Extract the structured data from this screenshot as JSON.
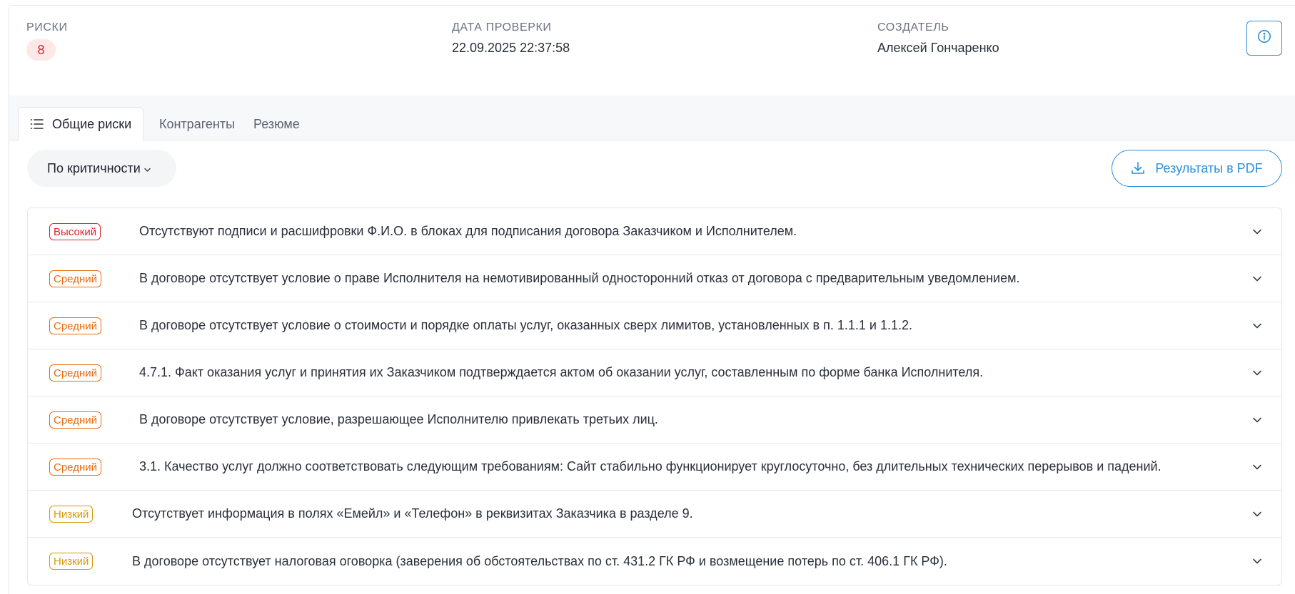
{
  "header": {
    "risks_label": "РИСКИ",
    "risks_count": "8",
    "date_label": "ДАТА ПРОВЕРКИ",
    "date_value": "22.09.2025 22:37:58",
    "creator_label": "СОЗДАТЕЛЬ",
    "creator_value": "Алексей Гончаренко",
    "info_icon": "info-circle-icon"
  },
  "tabs": [
    {
      "label": "Общие риски",
      "icon": "list-icon",
      "active": true
    },
    {
      "label": "Контрагенты",
      "active": false
    },
    {
      "label": "Резюме",
      "active": false
    }
  ],
  "toolbar": {
    "sort_label": "По критичности",
    "pdf_label": "Результаты в PDF",
    "pdf_icon": "download-icon"
  },
  "colors": {
    "accent": "#2f8fd6",
    "high": "#dc2626",
    "medium": "#ea6a0c",
    "low": "#d59a08"
  },
  "risks": [
    {
      "severity": "Высокий",
      "level": "high",
      "text": "Отсутствуют подписи и расшифровки Ф.И.О. в блоках для подписания договора Заказчиком и Исполнителем."
    },
    {
      "severity": "Средний",
      "level": "medium",
      "text": "В договоре отсутствует условие о праве Исполнителя на немотивированный односторонний отказ от договора с предварительным уведомлением."
    },
    {
      "severity": "Средний",
      "level": "medium",
      "text": "В договоре отсутствует условие о стоимости и порядке оплаты услуг, оказанных сверх лимитов, установленных в п. 1.1.1 и 1.1.2."
    },
    {
      "severity": "Средний",
      "level": "medium",
      "text": "4.7.1. Факт оказания услуг и принятия их Заказчиком подтверждается актом об оказании услуг, составленным по форме банка Исполнителя."
    },
    {
      "severity": "Средний",
      "level": "medium",
      "text": "В договоре отсутствует условие, разрешающее Исполнителю привлекать третьих лиц."
    },
    {
      "severity": "Средний",
      "level": "medium",
      "text": "3.1. Качество услуг должно соответствовать следующим требованиям: Сайт стабильно функционирует круглосуточно, без длительных технических перерывов и падений."
    },
    {
      "severity": "Низкий",
      "level": "low",
      "text": "Отсутствует информация в полях «Емейл» и «Телефон» в реквизитах Заказчика в разделе 9."
    },
    {
      "severity": "Низкий",
      "level": "low",
      "text": "В договоре отсутствует налоговая оговорка (заверения об обстоятельствах по ст. 431.2 ГК РФ и возмещение потерь по ст. 406.1 ГК РФ)."
    }
  ]
}
